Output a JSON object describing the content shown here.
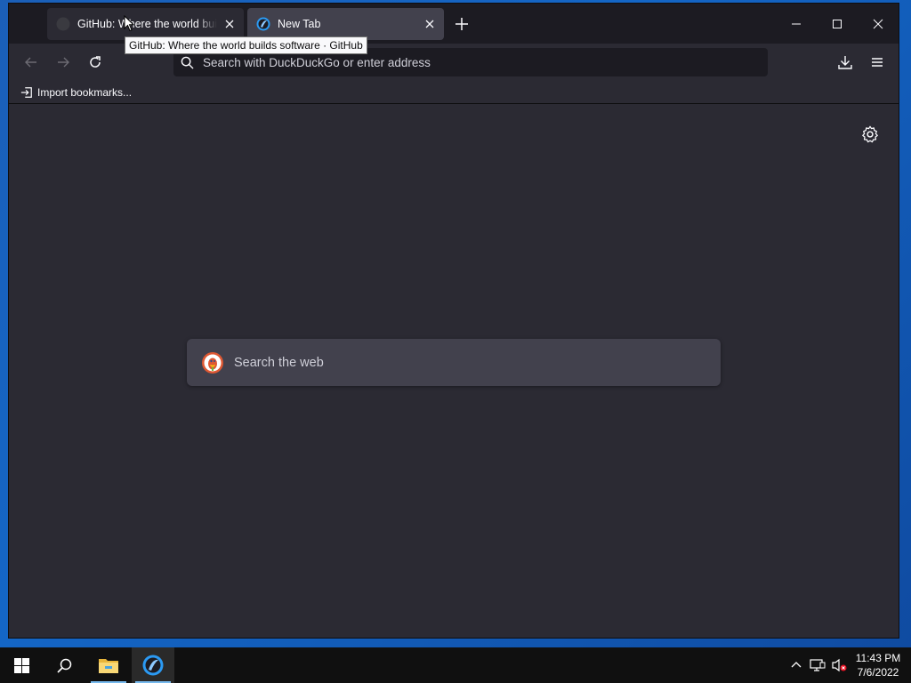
{
  "browser": {
    "tabs": [
      {
        "title": "GitHub: Where the world builds software · GitHub",
        "active": false,
        "favicon": "github-icon"
      },
      {
        "title": "New Tab",
        "active": true,
        "favicon": "duckduckgo-browser-icon"
      }
    ],
    "tooltip": "GitHub: Where the world builds software · GitHub",
    "urlbar": {
      "placeholder": "Search with DuckDuckGo or enter address",
      "value": ""
    },
    "bookmarks": {
      "import_label": "Import bookmarks..."
    }
  },
  "newtab": {
    "search": {
      "placeholder": "Search the web",
      "engine_icon": "duckduckgo-icon"
    }
  },
  "taskbar": {
    "clock_time": "11:43 PM",
    "clock_date": "7/6/2022"
  },
  "colors": {
    "accent": "#76b9ed",
    "chrome_bg": "#2b2a33",
    "titlebar_bg": "#1c1b22",
    "active_tab_bg": "#42414d",
    "taskbar_bg": "#101010",
    "desktop": "#1466c6"
  }
}
